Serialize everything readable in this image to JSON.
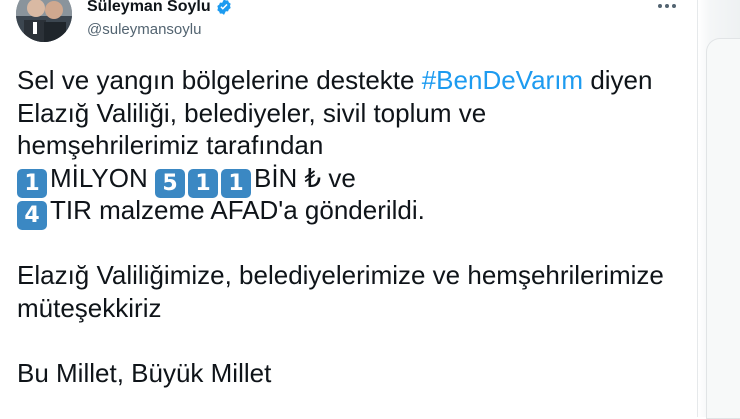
{
  "author": {
    "display_name": "Süleyman Soylu",
    "handle": "@suleymansoylu",
    "verified_icon": "verified-badge-icon",
    "verified_color": "#1d9bf0"
  },
  "menu_icon": "more-options-icon",
  "tweet": {
    "line1_before": "Sel ve yangın bölgelerine destekte ",
    "hashtag": "#BenDeVarım",
    "line1_after": " diyen",
    "line2": "Elazığ Valiliği, belediyeler, sivil toplum ve",
    "line3": "hemşehrilerimiz tarafından",
    "keycap_1": "1",
    "line4_word1": "MİLYON ",
    "keycap_2": "5",
    "keycap_3": "1",
    "keycap_4": "1",
    "line4_word2": "BİN ₺ ve",
    "keycap_5": "4",
    "line5": "TIR malzeme AFAD'a gönderildi.",
    "line6": "Elazığ Valiliğimize, belediyelerimize ve hemşehrilerimize",
    "line7": "müteşekkiriz",
    "line8": "Bu Millet, Büyük Millet"
  },
  "colors": {
    "text": "#0f1419",
    "secondary": "#536471",
    "link": "#1d9bf0",
    "keycap": "#3b88c3"
  }
}
